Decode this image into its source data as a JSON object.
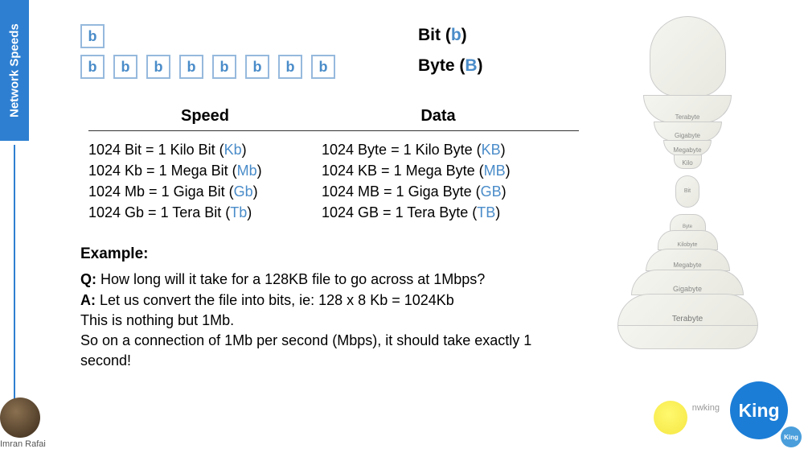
{
  "sidebar": {
    "title": "Network Speeds"
  },
  "bit": {
    "single": "b",
    "byte_bits": [
      "b",
      "b",
      "b",
      "b",
      "b",
      "b",
      "b",
      "b"
    ],
    "bit_label": "Bit (",
    "bit_abbr": "b",
    "byte_label": "Byte (",
    "byte_abbr": "B"
  },
  "table": {
    "speed_header": "Speed",
    "data_header": "Data",
    "speed": [
      {
        "text": "1024 Bit = 1 Kilo Bit (",
        "abbr": "Kb"
      },
      {
        "text": "1024 Kb = 1 Mega Bit (",
        "abbr": "Mb"
      },
      {
        "text": "1024 Mb = 1 Giga Bit (",
        "abbr": "Gb"
      },
      {
        "text": "1024 Gb = 1 Tera Bit (",
        "abbr": "Tb"
      }
    ],
    "data": [
      {
        "text": "1024 Byte = 1 Kilo Byte (",
        "abbr": "KB"
      },
      {
        "text": "1024 KB = 1 Mega Byte (",
        "abbr": "MB"
      },
      {
        "text": "1024 MB = 1 Giga Byte (",
        "abbr": "GB"
      },
      {
        "text": "1024 GB = 1 Tera Byte (",
        "abbr": "TB"
      }
    ]
  },
  "example": {
    "title": "Example:",
    "q_label": "Q:",
    "q_text": " How long will it take for a 128KB file to go across at 1Mbps?",
    "a_label": "A:",
    "a_text": " Let us convert the file into bits, ie: 128 x 8 Kb = 1024Kb",
    "line3": "This is nothing but 1Mb.",
    "line4": "So on a connection of 1Mb per second (Mbps), it should take exactly 1 second!"
  },
  "dolls": {
    "top1": "",
    "top2": "Terabyte",
    "top3": "Gigabyte",
    "top4": "Megabyte",
    "top5": "Kilo",
    "mid": "Bit",
    "b1": "Byte",
    "b2": "Kilobyte",
    "b3": "Megabyte",
    "b4": "Gigabyte",
    "b5": "Terabyte"
  },
  "author": {
    "name": "Imran Rafai"
  },
  "logo": {
    "king": "King",
    "small_king": "King",
    "watermark": "nwking"
  }
}
